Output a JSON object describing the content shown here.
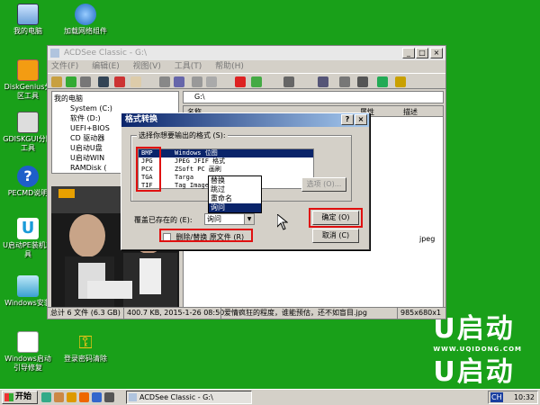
{
  "desktop": {
    "icons": [
      {
        "label": "我的电脑"
      },
      {
        "label": "加载网络组件"
      },
      {
        "label": "DiskGenius分区工具"
      },
      {
        "label": "GDISKGUI分区工具"
      },
      {
        "label": "PECMD说明"
      },
      {
        "label": "U启动PE装机工具"
      },
      {
        "label": "Windows安装"
      },
      {
        "label": "Windows启动引导修复"
      },
      {
        "label": "登录密码清除"
      }
    ],
    "brand": {
      "text": "U启动",
      "url": "WWW.UQIDONG.COM"
    }
  },
  "window": {
    "title": "ACDSee Classic - G:\\",
    "menu": [
      "文件(F)",
      "编辑(E)",
      "视图(V)",
      "工具(T)",
      "帮助(H)"
    ],
    "tree": [
      "我的电脑",
      "System (C:)",
      "软件 (D:)",
      "UEFI+BIOS",
      "CD 驱动器",
      "U启动U盘",
      "U启动WIN",
      "RAMDisk ("
    ],
    "address": "G:\\",
    "columns": [
      "名称",
      "属性",
      "描述"
    ],
    "file_type": "jpeg",
    "status": {
      "total": "总计 6 文件 (6.3 GB)",
      "size": "400.7 KB, 2015-1-26 08:50",
      "filename": "爱情疯狂的程度，谁能预估，还不如盲目.jpg",
      "dims": "985x680x1"
    }
  },
  "dialog": {
    "title": "格式转换",
    "group_label": "选择你想要输出的格式 (S):",
    "formats": [
      {
        "code": "BMP",
        "desc": "Windows 位图"
      },
      {
        "code": "JPG",
        "desc": "JPEG JFIF 格式"
      },
      {
        "code": "PCX",
        "desc": "ZSoft PC 画刷"
      },
      {
        "code": "TGA",
        "desc": "Targa"
      },
      {
        "code": "TIF",
        "desc": "Tag Image..."
      }
    ],
    "options_button": "选项 (O)...",
    "overwrite_label": "覆盖已存在的 (E):",
    "overwrite_value": "询问",
    "overwrite_options": [
      "替换",
      "跳过",
      "重命名",
      "询问"
    ],
    "delete_checkbox": "删除/替换 原文件 (R)",
    "ok": "确定 (O)",
    "cancel": "取消 (C)"
  },
  "taskbar": {
    "start": "开始",
    "task": "ACDSee Classic - G:\\",
    "tray_lang": "CH",
    "clock": "10:32"
  }
}
